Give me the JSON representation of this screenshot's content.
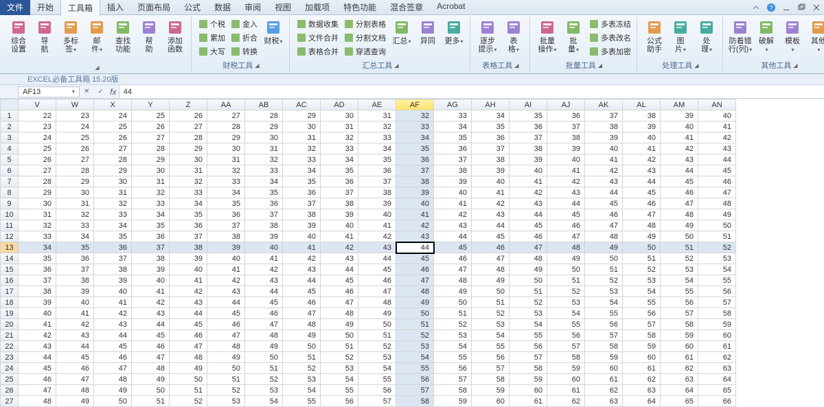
{
  "menu": {
    "file": "文件",
    "tabs": [
      "开始",
      "工具箱",
      "插入",
      "页面布局",
      "公式",
      "数据",
      "审阅",
      "视图",
      "加载项",
      "特色功能",
      "混合签章",
      "Acrobat"
    ],
    "active_index": 1
  },
  "ribbon": {
    "groups": [
      {
        "label": "EXCEL必备工具箱 15.20版",
        "big": [
          {
            "l1": "综合",
            "l2": "设置"
          },
          {
            "l1": "导",
            "l2": "航"
          },
          {
            "l1": "多标",
            "l2": "签",
            "dd": true
          },
          {
            "l1": "邮",
            "l2": "件",
            "dd": true
          },
          {
            "l1": "查找",
            "l2": "功能"
          },
          {
            "l1": "帮",
            "l2": "助"
          },
          {
            "l1": "添加",
            "l2": "函数"
          }
        ]
      },
      {
        "label": "财税工具",
        "mini_cols": [
          [
            {
              "t": "个税"
            },
            {
              "t": "累加"
            },
            {
              "t": "大写"
            }
          ],
          [
            {
              "t": "金入"
            },
            {
              "t": "折合"
            },
            {
              "t": "转换"
            }
          ]
        ],
        "extra_big": [
          {
            "l1": "财税",
            "dd": true
          }
        ]
      },
      {
        "label": "汇总工具",
        "mini_cols": [
          [
            {
              "t": "数据收集"
            },
            {
              "t": "文件合并"
            },
            {
              "t": "表格合并"
            }
          ],
          [
            {
              "t": "分割表格"
            },
            {
              "t": "分割文档"
            },
            {
              "t": "穿透查询"
            }
          ]
        ],
        "extra_big": [
          {
            "l1": "汇总",
            "dd": true
          },
          {
            "l1": "异同",
            "dd": false
          },
          {
            "l1": "更多",
            "dd": true
          }
        ]
      },
      {
        "label": "表格工具",
        "big": [
          {
            "l1": "逐步",
            "l2": "提示",
            "dd": true
          },
          {
            "l1": "表",
            "l2": "格",
            "dd": true
          }
        ]
      },
      {
        "label": "批量工具",
        "big": [
          {
            "l1": "批量",
            "l2": "操作",
            "dd": true
          },
          {
            "l1": "批",
            "l2": "量",
            "dd": true
          }
        ],
        "mini_cols": [
          [
            {
              "t": "多表冻结"
            },
            {
              "t": "多表改名"
            },
            {
              "t": "多表加密"
            }
          ]
        ]
      },
      {
        "label": "处理工具",
        "big": [
          {
            "l1": "公式",
            "l2": "助手"
          },
          {
            "l1": "图",
            "l2": "片",
            "dd": true
          },
          {
            "l1": "处",
            "l2": "理",
            "dd": true
          }
        ]
      },
      {
        "label": "其他工具",
        "big": [
          {
            "l1": "防着错",
            "l2": "行(列)",
            "dd": true
          },
          {
            "l1": "破解",
            "dd": true
          },
          {
            "l1": "模板",
            "dd": true
          },
          {
            "l1": "其他",
            "dd": true
          }
        ]
      }
    ]
  },
  "namebox": "AF13",
  "formula": "44",
  "grid": {
    "columns": [
      "V",
      "W",
      "X",
      "Y",
      "Z",
      "AA",
      "AB",
      "AC",
      "AD",
      "AE",
      "AF",
      "AG",
      "AH",
      "AI",
      "AJ",
      "AK",
      "AL",
      "AM",
      "AN"
    ],
    "col_offset": 0,
    "first_value": 22,
    "rows": 27,
    "selected_col": "AF",
    "selected_row": 13
  }
}
